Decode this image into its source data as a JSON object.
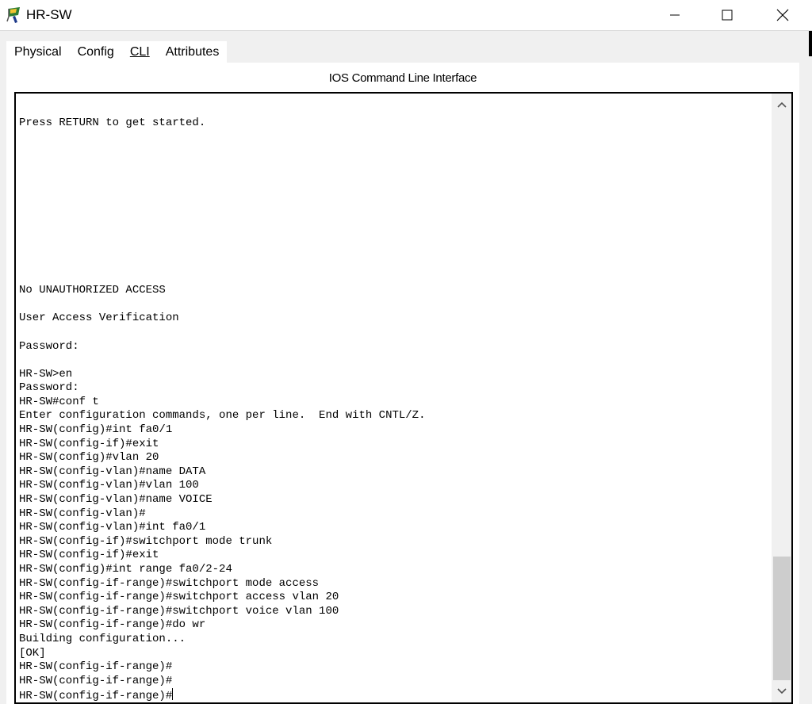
{
  "window": {
    "title": "HR-SW",
    "controls": {
      "minimize": "—",
      "maximize": "□",
      "close": "✕"
    }
  },
  "tabs": [
    {
      "label": "Physical",
      "active": false
    },
    {
      "label": "Config",
      "active": false
    },
    {
      "label": "CLI",
      "active": true
    },
    {
      "label": "Attributes",
      "active": false
    }
  ],
  "panel": {
    "title": "IOS Command Line Interface"
  },
  "terminal": {
    "lines": [
      "Press RETURN to get started.",
      "",
      "",
      "",
      "",
      "",
      "",
      "",
      "",
      "",
      "",
      "",
      "No UNAUTHORIZED ACCESS",
      "",
      "User Access Verification",
      "",
      "Password:",
      "",
      "HR-SW>en",
      "Password:",
      "HR-SW#conf t",
      "Enter configuration commands, one per line.  End with CNTL/Z.",
      "HR-SW(config)#int fa0/1",
      "HR-SW(config-if)#exit",
      "HR-SW(config)#vlan 20",
      "HR-SW(config-vlan)#name DATA",
      "HR-SW(config-vlan)#vlan 100",
      "HR-SW(config-vlan)#name VOICE",
      "HR-SW(config-vlan)#",
      "HR-SW(config-vlan)#int fa0/1",
      "HR-SW(config-if)#switchport mode trunk",
      "HR-SW(config-if)#exit",
      "HR-SW(config)#int range fa0/2-24",
      "HR-SW(config-if-range)#switchport mode access",
      "HR-SW(config-if-range)#switchport access vlan 20",
      "HR-SW(config-if-range)#switchport voice vlan 100",
      "HR-SW(config-if-range)#do wr",
      "Building configuration...",
      "[OK]",
      "HR-SW(config-if-range)#",
      "HR-SW(config-if-range)#"
    ],
    "prompt": "HR-SW(config-if-range)#"
  },
  "icons": {
    "app": "packet-tracer-switch-icon",
    "scroll_up": "chevron-up-icon",
    "scroll_down": "chevron-down-icon"
  },
  "colors": {
    "tab_underline": "#1f3864",
    "scroll_thumb": "#cdcdcd"
  }
}
